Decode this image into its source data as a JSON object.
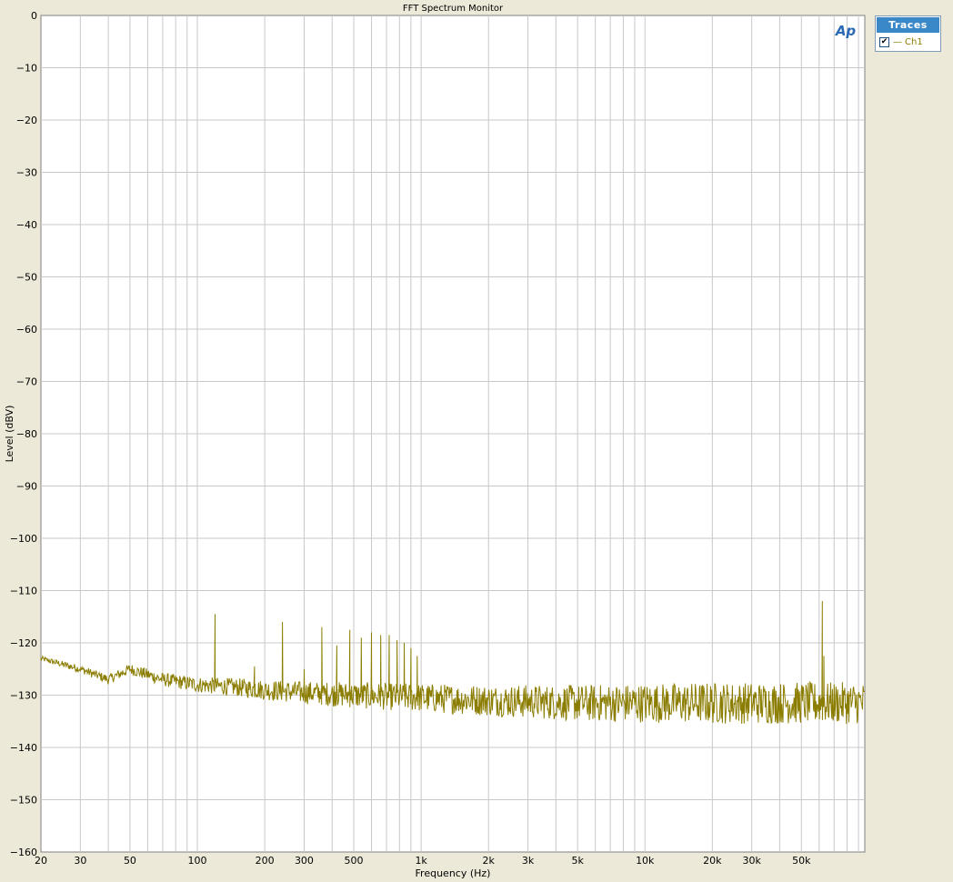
{
  "colors": {
    "trace": "#8b7d00",
    "grid": "#c8c8c8",
    "plot_bg": "#ffffff",
    "window_bg": "#ece9d8",
    "ap_logo": "#2a6ab4"
  },
  "logo_text": "Ap",
  "traces_panel": {
    "header": "Traces",
    "items": [
      {
        "name": "Ch1",
        "checked": true,
        "check_glyph": "✔",
        "swatch": "—"
      }
    ]
  },
  "chart_data": {
    "type": "line",
    "title": "FFT Spectrum Monitor",
    "xlabel": "Frequency (Hz)",
    "ylabel": "Level (dBV)",
    "x_scale": "log",
    "xlim": [
      20,
      96000
    ],
    "ylim": [
      -160,
      0
    ],
    "grid": true,
    "legend_position": "top-right",
    "x_ticks": [
      {
        "value": 20,
        "label": "20"
      },
      {
        "value": 30,
        "label": "30"
      },
      {
        "value": 50,
        "label": "50"
      },
      {
        "value": 100,
        "label": "100"
      },
      {
        "value": 200,
        "label": "200"
      },
      {
        "value": 300,
        "label": "300"
      },
      {
        "value": 500,
        "label": "500"
      },
      {
        "value": 1000,
        "label": "1k"
      },
      {
        "value": 2000,
        "label": "2k"
      },
      {
        "value": 3000,
        "label": "3k"
      },
      {
        "value": 5000,
        "label": "5k"
      },
      {
        "value": 10000,
        "label": "10k"
      },
      {
        "value": 20000,
        "label": "20k"
      },
      {
        "value": 30000,
        "label": "30k"
      },
      {
        "value": 50000,
        "label": "50k"
      }
    ],
    "y_ticks": [
      0,
      -10,
      -20,
      -30,
      -40,
      -50,
      -60,
      -70,
      -80,
      -90,
      -100,
      -110,
      -120,
      -130,
      -140,
      -150,
      -160
    ],
    "series": [
      {
        "name": "Ch1",
        "color": "#8b7d00",
        "noise_floor": {
          "x": [
            20,
            30,
            40,
            50,
            70,
            100,
            150,
            200,
            300,
            500,
            1000,
            2000,
            5000,
            10000,
            20000,
            50000,
            96000
          ],
          "y": [
            -123,
            -125,
            -127,
            -125,
            -127,
            -128,
            -128.5,
            -129,
            -129.5,
            -130,
            -130.5,
            -131,
            -131.5,
            -131.5,
            -131.5,
            -131.5,
            -131.5
          ]
        },
        "noise_spread": {
          "x": [
            20,
            100,
            500,
            2000,
            5000,
            20000,
            96000
          ],
          "y": [
            0.5,
            1.5,
            2.5,
            3.0,
            3.5,
            4.0,
            4.0
          ]
        },
        "peaks": {
          "x": [
            120,
            180,
            240,
            300,
            360,
            420,
            480,
            540,
            600,
            660,
            720,
            780,
            840,
            900,
            960,
            62000,
            63000
          ],
          "y": [
            -114.5,
            -124.5,
            -116,
            -125,
            -117,
            -120.5,
            -117.5,
            -119,
            -118,
            -118.5,
            -118.5,
            -119.5,
            -120,
            -121,
            -122.5,
            -112,
            -122.5
          ]
        }
      }
    ]
  }
}
